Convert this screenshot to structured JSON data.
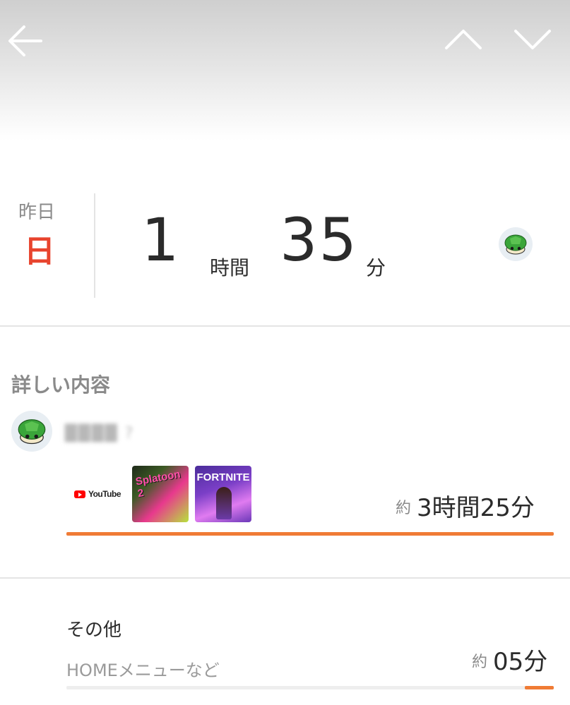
{
  "colors": {
    "accent": "#f07b35",
    "day_red": "#e8442e",
    "text_primary": "#2b2b2b",
    "text_secondary": "#8a8a8a",
    "divider": "#e4e4e4"
  },
  "header": {
    "back_icon": "arrow-left-icon",
    "prev_icon": "chevron-up-icon",
    "next_icon": "chevron-down-icon"
  },
  "summary": {
    "day_label": "昨日",
    "day_value": "日",
    "hours": "1",
    "hours_unit": "時間",
    "minutes": "35",
    "minutes_unit": "分",
    "avatar_icon": "green-shell-icon"
  },
  "details": {
    "section_title": "詳しい内容",
    "user": {
      "name": "████ ?",
      "avatar_icon": "green-shell-icon"
    },
    "apps": [
      {
        "name": "YouTube"
      },
      {
        "name": "Splatoon 2"
      },
      {
        "name": "FORTNITE"
      }
    ],
    "approx_label": "約",
    "total": "3時間25分",
    "progress": 1.0
  },
  "other": {
    "title": "その他",
    "subtitle": "HOMEメニューなど",
    "approx_label": "約",
    "time": "05分",
    "progress": 0.06
  }
}
